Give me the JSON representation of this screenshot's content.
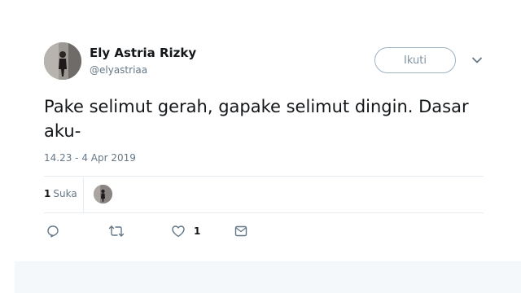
{
  "user": {
    "display_name": "Ely Astria Rizky",
    "handle": "@elyastriaa"
  },
  "follow_button": {
    "label": "Ikuti"
  },
  "tweet": {
    "text": "Pake selimut gerah, gapake selimut dingin. Dasar aku-",
    "timestamp": "14.23 - 4 Apr 2019"
  },
  "stats": {
    "likes_count": "1",
    "likes_label": "Suka"
  },
  "actions": {
    "reply": {
      "icon": "reply-icon"
    },
    "retweet": {
      "icon": "retweet-icon"
    },
    "like": {
      "icon": "heart-icon",
      "count": "1"
    },
    "dm": {
      "icon": "envelope-icon"
    }
  },
  "colors": {
    "text_primary": "#14171a",
    "text_secondary": "#657786",
    "border": "#e6ecf0",
    "follow_border": "#9fb2c0"
  }
}
